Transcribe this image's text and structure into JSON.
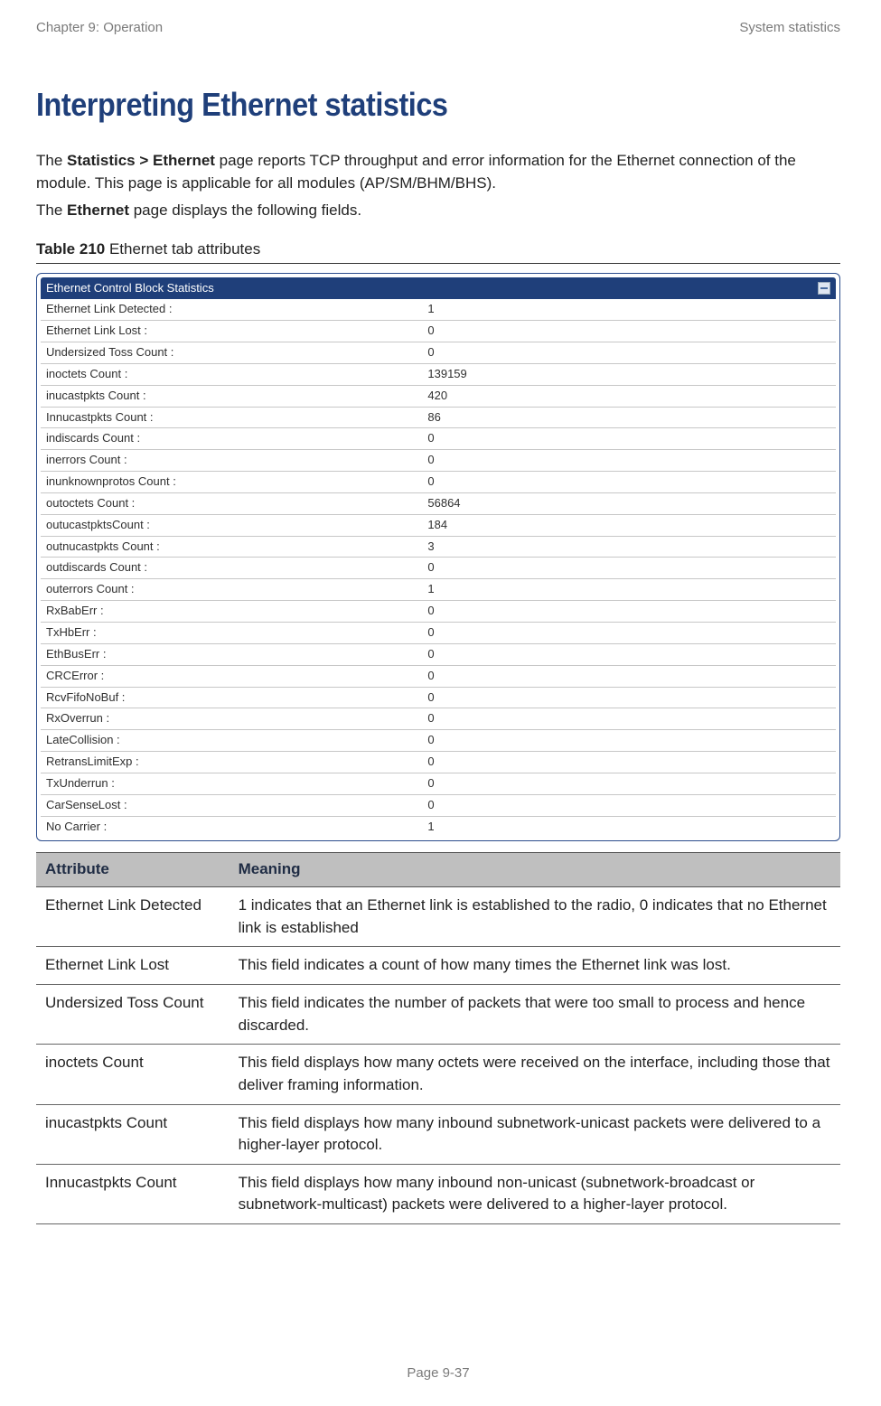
{
  "header": {
    "left": "Chapter 9:  Operation",
    "right": "System statistics"
  },
  "title": "Interpreting Ethernet statistics",
  "intro": {
    "p1a": "The ",
    "p1b": "Statistics > Ethernet",
    "p1c": " page reports TCP throughput and error information for the Ethernet connection of the module. This page is applicable for all modules (AP/SM/BHM/BHS).",
    "p2a": "The ",
    "p2b": "Ethernet",
    "p2c": " page displays the following fields."
  },
  "table_ref": {
    "label": "Table 210",
    "text": " Ethernet tab attributes"
  },
  "stats_title": "Ethernet Control Block Statistics",
  "stats": [
    {
      "k": "Ethernet Link Detected :",
      "v": "1"
    },
    {
      "k": "Ethernet Link Lost :",
      "v": "0"
    },
    {
      "k": "Undersized Toss Count :",
      "v": "0"
    },
    {
      "k": "inoctets Count :",
      "v": "139159"
    },
    {
      "k": "inucastpkts Count :",
      "v": "420"
    },
    {
      "k": "Innucastpkts Count :",
      "v": "86"
    },
    {
      "k": "indiscards Count :",
      "v": "0"
    },
    {
      "k": "inerrors Count :",
      "v": "0"
    },
    {
      "k": "inunknownprotos Count :",
      "v": "0"
    },
    {
      "k": "outoctets Count :",
      "v": "56864"
    },
    {
      "k": "outucastpktsCount :",
      "v": "184"
    },
    {
      "k": "outnucastpkts Count :",
      "v": "3"
    },
    {
      "k": "outdiscards Count :",
      "v": "0"
    },
    {
      "k": "outerrors Count :",
      "v": "1"
    },
    {
      "k": "RxBabErr :",
      "v": "0"
    },
    {
      "k": "TxHbErr :",
      "v": "0"
    },
    {
      "k": "EthBusErr :",
      "v": "0"
    },
    {
      "k": "CRCError :",
      "v": "0"
    },
    {
      "k": "RcvFifoNoBuf :",
      "v": "0"
    },
    {
      "k": "RxOverrun :",
      "v": "0"
    },
    {
      "k": "LateCollision :",
      "v": "0"
    },
    {
      "k": "RetransLimitExp :",
      "v": "0"
    },
    {
      "k": "TxUnderrun :",
      "v": "0"
    },
    {
      "k": "CarSenseLost :",
      "v": "0"
    },
    {
      "k": "No Carrier :",
      "v": "1"
    }
  ],
  "attr_head": {
    "a": "Attribute",
    "m": "Meaning"
  },
  "attrs": [
    {
      "a": "Ethernet Link Detected",
      "m": "1 indicates that an Ethernet link is established to the radio, 0 indicates that no Ethernet link is established"
    },
    {
      "a": "Ethernet Link Lost",
      "m": "This field indicates a count of how many times the Ethernet link was lost."
    },
    {
      "a": "Undersized Toss Count",
      "m": "This field indicates the number of packets that were too small to process and hence discarded."
    },
    {
      "a": "inoctets Count",
      "m": "This field displays how many octets were received on the interface, including those that deliver framing information."
    },
    {
      "a": "inucastpkts Count",
      "m": "This field displays how many inbound subnetwork-unicast packets were delivered to a higher-layer protocol."
    },
    {
      "a": "Innucastpkts Count",
      "m": "This field displays how many inbound non-unicast (subnetwork-broadcast or subnetwork-multicast) packets were delivered to a higher-layer protocol."
    }
  ],
  "footer": "Page 9-37"
}
